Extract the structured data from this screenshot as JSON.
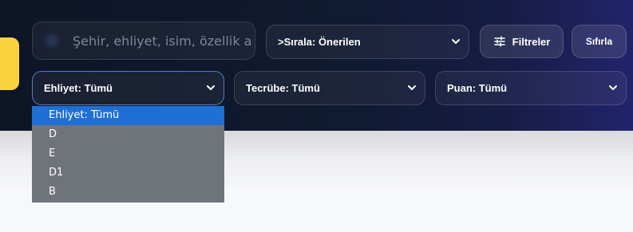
{
  "search": {
    "placeholder": "Şehir, ehliyet, isim, özellik ar",
    "value": ""
  },
  "sort": {
    "label": ">Sırala: Önerilen"
  },
  "buttons": {
    "filters_label": "Filtreler",
    "reset_label": "Sıfırla"
  },
  "filters": {
    "license": {
      "label": "Ehliyet: Tümü"
    },
    "experience": {
      "label": "Tecrübe: Tümü"
    },
    "rating": {
      "label": "Puan: Tümü"
    }
  },
  "license_dropdown": {
    "selected_index": 0,
    "options": [
      "Ehliyet: Tümü",
      "D",
      "E",
      "D1",
      "B"
    ]
  },
  "colors": {
    "accent_yellow": "#f8d33d",
    "selected_option": "#1f6fd5",
    "panel_bg": "#0e1526"
  },
  "icons": {
    "search": "search-icon",
    "filters": "sliders-icon",
    "chevron": "chevron-down-icon"
  }
}
